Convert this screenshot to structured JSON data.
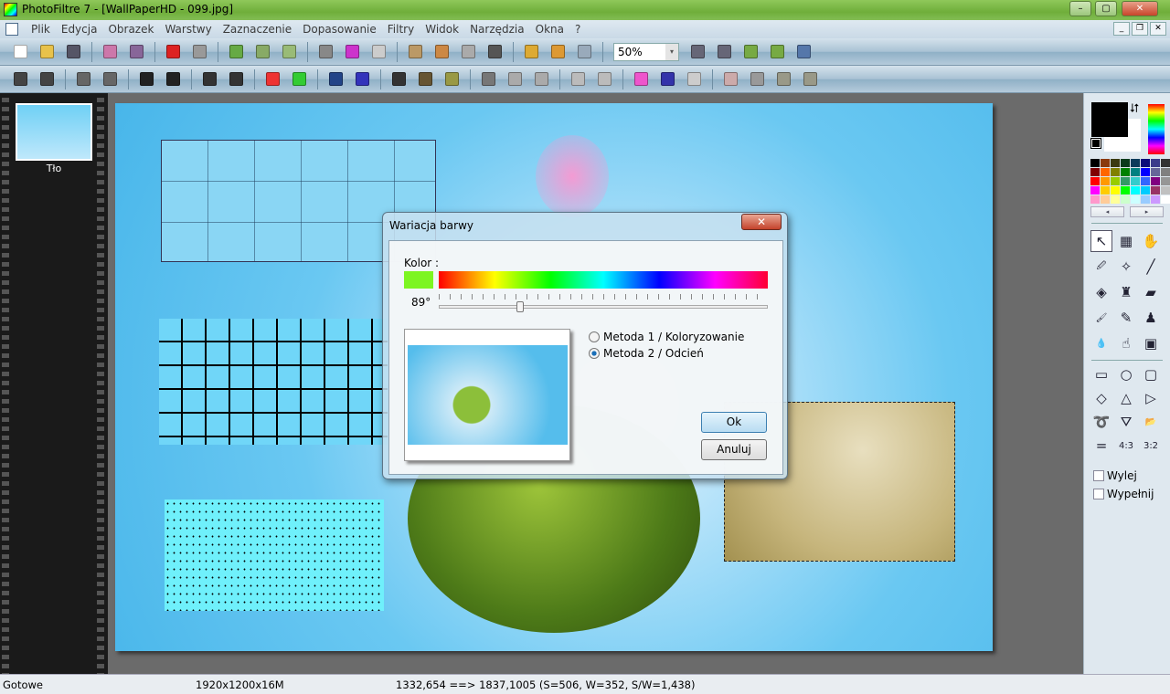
{
  "window": {
    "title": "PhotoFiltre 7 - [WallPaperHD - 099.jpg]",
    "min": "–",
    "max": "▢",
    "close": "✕"
  },
  "menu": [
    "Plik",
    "Edycja",
    "Obrazek",
    "Warstwy",
    "Zaznaczenie",
    "Dopasowanie",
    "Filtry",
    "Widok",
    "Narzędzia",
    "Okna",
    "?"
  ],
  "mdi": {
    "min": "_",
    "restore": "❐",
    "close": "✕"
  },
  "toolbar1": {
    "groups": [
      [
        [
          "new-icon",
          "#fff"
        ],
        [
          "open-icon",
          "#e8c24a"
        ],
        [
          "save-icon",
          "#556"
        ]
      ],
      [
        [
          "print-icon",
          "#c7a"
        ],
        [
          "scan-icon",
          "#869"
        ]
      ],
      [
        [
          "undo-icon",
          "#d22"
        ],
        [
          "redo-icon",
          "#999"
        ]
      ],
      [
        [
          "layer-image-icon",
          "#6a4"
        ],
        [
          "layer-copy-icon",
          "#8a6"
        ],
        [
          "layer-paste-icon",
          "#9b7"
        ]
      ],
      [
        [
          "gradient-icon",
          "#888"
        ],
        [
          "color-grid-icon",
          "#c3c"
        ],
        [
          "transparency-icon",
          "#ccc"
        ]
      ],
      [
        [
          "layer-manager-icon",
          "#b96"
        ],
        [
          "layer-effect-icon",
          "#c84"
        ],
        [
          "selection-icon",
          "#aaa"
        ],
        [
          "text-icon",
          "#555"
        ]
      ],
      [
        [
          "explorer-icon",
          "#da3"
        ],
        [
          "automation-icon",
          "#d93"
        ],
        [
          "batch-icon",
          "#9ab"
        ]
      ]
    ],
    "zoom": "50%",
    "zoom_tools": [
      [
        "zoom-in-icon",
        "#667"
      ],
      [
        "zoom-out-icon",
        "#667"
      ],
      [
        "fit-image-icon",
        "#7a4"
      ],
      [
        "actual-size-icon",
        "#7a4"
      ],
      [
        "fullscreen-icon",
        "#57a"
      ]
    ]
  },
  "toolbar2": {
    "groups": [
      [
        [
          "auto-levels-icon",
          "#444"
        ],
        [
          "auto-contrast-icon",
          "#444"
        ]
      ],
      [
        [
          "brightness-minus-icon",
          "#666"
        ],
        [
          "brightness-plus-icon",
          "#666"
        ]
      ],
      [
        [
          "contrast-minus-icon",
          "#222"
        ],
        [
          "contrast-plus-icon",
          "#222"
        ]
      ],
      [
        [
          "gamma-minus-icon",
          "#333"
        ],
        [
          "gamma-plus-icon",
          "#333"
        ]
      ],
      [
        [
          "saturation-minus-icon",
          "#e33"
        ],
        [
          "saturation-plus-icon",
          "#3c3"
        ]
      ],
      [
        [
          "histogram-icon",
          "#248"
        ],
        [
          "rgb-levels-icon",
          "#33b"
        ]
      ],
      [
        [
          "grid-dark-icon",
          "#333"
        ],
        [
          "grid-brown-icon",
          "#653"
        ],
        [
          "grid-olive-icon",
          "#994"
        ]
      ],
      [
        [
          "sharpen-icon",
          "#777"
        ],
        [
          "blur-icon",
          "#aaa"
        ],
        [
          "blur-more-icon",
          "#aaa"
        ]
      ],
      [
        [
          "soften-icon",
          "#bbb"
        ],
        [
          "soften-more-icon",
          "#bbb"
        ]
      ],
      [
        [
          "color-gradient-icon",
          "#e5c"
        ],
        [
          "blue-gradient-icon",
          "#33a"
        ],
        [
          "disabled-effect-icon",
          "#ccc"
        ]
      ],
      [
        [
          "flip-horizontal-icon",
          "#caa"
        ],
        [
          "flip-vertical-icon",
          "#999"
        ],
        [
          "rotate-left-icon",
          "#998"
        ],
        [
          "rotate-right-icon",
          "#998"
        ]
      ]
    ]
  },
  "layers": {
    "items": [
      {
        "label": "Tło"
      }
    ]
  },
  "dialog": {
    "title": "Wariacja barwy",
    "close": "✕",
    "kolor_label": "Kolor :",
    "swatch_color": "#7df522",
    "hue_degrees": "89°",
    "hue_value": 89,
    "hue_max": 360,
    "radios": [
      {
        "label": "Metoda 1 / Koloryzowanie",
        "checked": false
      },
      {
        "label": "Metoda 2 / Odcień",
        "checked": true
      }
    ],
    "ok": "Ok",
    "cancel": "Anuluj"
  },
  "panel": {
    "fg_color": "#000000",
    "bg_color": "#ffffff",
    "swap": "⮃",
    "prev": "◂",
    "next": "▸",
    "palette": [
      "#000000",
      "#8b3a0e",
      "#3a3a10",
      "#0b3b1b",
      "#0b3b5b",
      "#0b0b7b",
      "#3b3b8b",
      "#333333",
      "#800000",
      "#ff6600",
      "#808000",
      "#008000",
      "#008080",
      "#0000ff",
      "#666699",
      "#808080",
      "#ff0000",
      "#ff9900",
      "#99cc00",
      "#339966",
      "#33cccc",
      "#3366ff",
      "#800080",
      "#969696",
      "#ff00ff",
      "#ffcc00",
      "#ffff00",
      "#00ff00",
      "#00ffff",
      "#00ccff",
      "#993366",
      "#c0c0c0",
      "#ff99cc",
      "#ffcc99",
      "#ffff99",
      "#ccffcc",
      "#ccffff",
      "#99ccff",
      "#cc99ff",
      "#ffffff"
    ],
    "tools": [
      [
        "select-arrow-icon",
        "↖"
      ],
      [
        "image-mask-icon",
        "▦"
      ],
      [
        "hand-icon",
        "✋"
      ],
      [
        "eyedropper-icon",
        "🖉"
      ],
      [
        "magic-wand-icon",
        "✧"
      ],
      [
        "line-icon",
        "╱"
      ],
      [
        "paint-bucket-icon",
        "◈"
      ],
      [
        "spray-icon",
        "♜"
      ],
      [
        "eraser-icon",
        "▰"
      ],
      [
        "brush-icon",
        "🖌"
      ],
      [
        "advanced-brush-icon",
        "✎"
      ],
      [
        "clone-stamp-icon",
        "♟"
      ],
      [
        "blur-drop-icon",
        "💧"
      ],
      [
        "smudge-finger-icon",
        "☝"
      ],
      [
        "portrait-icon",
        "▣"
      ]
    ],
    "shapes": [
      [
        "rectangle-icon",
        "▭"
      ],
      [
        "ellipse-icon",
        "○"
      ],
      [
        "rounded-rect-icon",
        "▢"
      ],
      [
        "diamond-icon",
        "◇"
      ],
      [
        "triangle-icon",
        "△"
      ],
      [
        "triangle-right-icon",
        "▷"
      ],
      [
        "lasso-icon",
        "➰"
      ],
      [
        "polygon-lasso-icon",
        "⛛"
      ],
      [
        "open-shape-icon",
        "📂"
      ],
      [
        "ratio-free-icon",
        "="
      ],
      [
        "ratio-4-3-icon",
        "4:3"
      ],
      [
        "ratio-3-2-icon",
        "3:2"
      ]
    ],
    "checkboxes": [
      {
        "label": "Wylej",
        "checked": false
      },
      {
        "label": "Wypełnij",
        "checked": false
      }
    ]
  },
  "status": {
    "state": "Gotowe",
    "size": "1920x1200x16M",
    "selection": "1332,654 ==> 1837,1005 (S=506, W=352, S/W=1,438)"
  }
}
